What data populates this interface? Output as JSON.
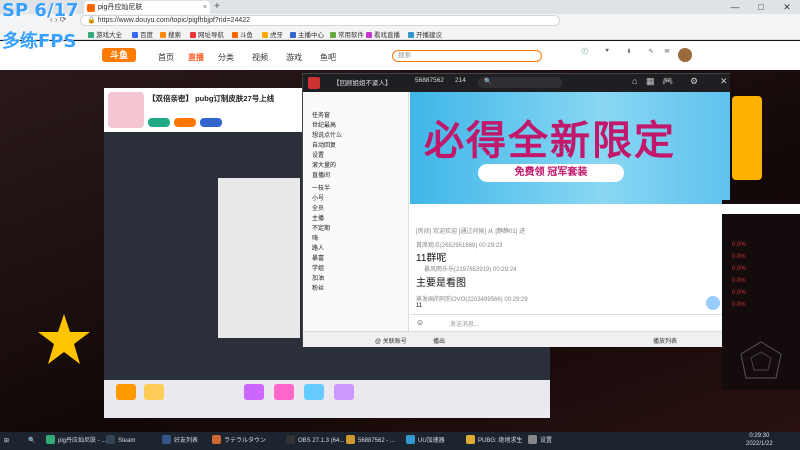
{
  "browser": {
    "tab_title": "pig丹应灿尼肤",
    "url": "https://www.douyu.com/topic/pigfhbjpf?rid=24422",
    "bookmarks": [
      "游戏大全",
      "百度",
      "搜索",
      "网址导航",
      "斗鱼",
      "虎牙",
      "主播中心",
      "常用软件",
      "看戏直播",
      "开播建议"
    ]
  },
  "site": {
    "logo": "斗鱼",
    "nav": [
      "首页",
      "直播",
      "分类",
      "视频",
      "游戏",
      "鱼吧"
    ],
    "active_nav": "直播",
    "search_placeholder": "搜索"
  },
  "stream": {
    "room_title": "【双倍亲密】 pubg订制皮肤27号上线",
    "overlay_title": "【回顾姐姐不紧人】",
    "overlay_stats": [
      "56887562",
      "214"
    ],
    "banner_text": "必得全新限定",
    "banner_button": "免费领 冠军套装",
    "messages": [
      {
        "meta": "[房间] 欢迎欢迎 [通过问候] 从 [静静01] 进 ",
        "body": ""
      },
      {
        "meta": "首席观点(2652951869) 00:29:23",
        "body": "11群呢"
      },
      {
        "meta": "暴风雨乐乐(2197653919) 00:29:24",
        "body": "主要是看图"
      },
      {
        "meta": "蒸发画的阿豹OVO(2203499566) 00:29:29",
        "body": "11"
      }
    ],
    "input_placeholder": "发送消息...",
    "side_items": [
      "任务窗",
      "世纪最高",
      "想说点什么",
      "自动回复",
      "设置",
      "滚大量的",
      "直播间",
      "一枝半",
      "小号",
      "全员",
      "主播",
      "不定期",
      "嗨",
      "路人",
      "暴富",
      "学姐",
      "加油",
      "粉丝"
    ],
    "bottom_bar": [
      "@ 关联账号",
      "播出",
      "播放列表"
    ]
  },
  "right_panel": {
    "rows": [
      "0.0%",
      "0.0%",
      "0.0%",
      "0.0%",
      "0.0%",
      "0.0%"
    ]
  },
  "taskbar": {
    "items": [
      "pig丹应灿尼肤 - ...",
      "Steam",
      "好友列表",
      "ラテラルタウン",
      "OBS 27.1.3 (64...",
      "56887562 - ...",
      "UU加速器",
      "PUBG: 绝地求生",
      "设置"
    ],
    "time": "0:29:30",
    "date": "2022/1/22"
  },
  "overlay_fps": {
    "line1": "SP 6/17",
    "line2": "多练FPS"
  },
  "colors": {
    "accent": "#ff7a00",
    "banner_pink": "#c2186b",
    "taskbar": "#1c2430"
  }
}
